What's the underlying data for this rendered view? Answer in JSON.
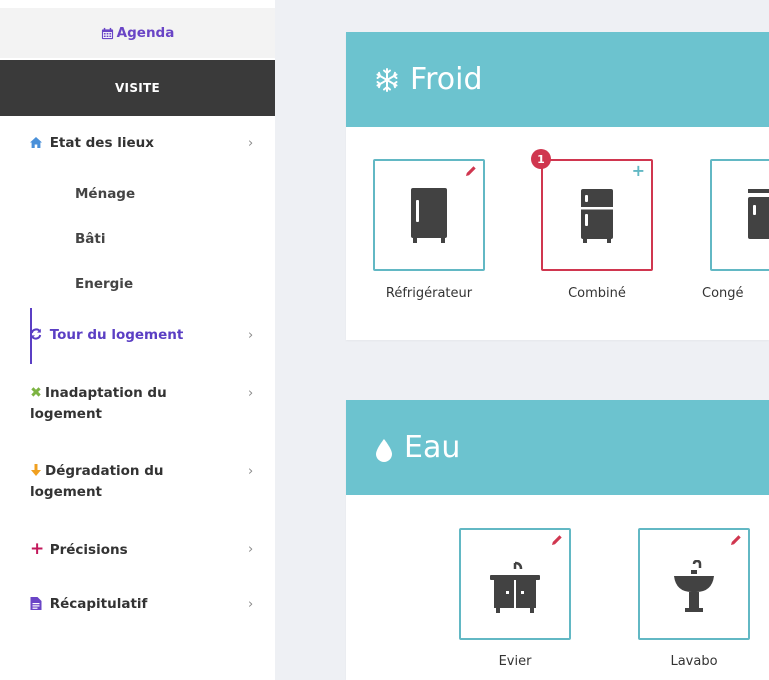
{
  "sidebar": {
    "agenda_label": "Agenda",
    "section_label": "VISITE",
    "items": [
      {
        "label": "Etat des lieux",
        "icon": "home-icon",
        "color": "#4a90d9"
      },
      {
        "label": "Tour du logement",
        "icon": "refresh-icon",
        "color": "#5b3fc4",
        "active": true
      },
      {
        "label": "Inadaptation du logement",
        "icon": "times-icon",
        "color": "#7cb342"
      },
      {
        "label": "Dégradation du logement",
        "icon": "arrow-down-icon",
        "color": "#f0a020"
      },
      {
        "label": "Précisions",
        "icon": "plus-icon",
        "color": "#c2185b"
      },
      {
        "label": "Récapitulatif",
        "icon": "file-icon",
        "color": "#6a45c6"
      }
    ],
    "sub_items": [
      {
        "label": "Ménage"
      },
      {
        "label": "Bâti"
      },
      {
        "label": "Energie"
      }
    ],
    "chevron": "›"
  },
  "sections": [
    {
      "title": "Froid",
      "icon": "snowflake-icon",
      "tiles": [
        {
          "label": "Réfrigérateur",
          "icon": "refrigerator-icon",
          "action": "edit"
        },
        {
          "label": "Combiné",
          "icon": "combined-fridge-icon",
          "action": "add",
          "badge": "1"
        },
        {
          "label": "Congé",
          "icon": "freezer-icon",
          "action": "edit"
        }
      ]
    },
    {
      "title": "Eau",
      "icon": "water-drop-icon",
      "tiles": [
        {
          "label": "Evier",
          "icon": "sink-icon",
          "action": "edit"
        },
        {
          "label": "Lavabo",
          "icon": "washbasin-icon",
          "action": "edit"
        }
      ]
    }
  ],
  "colors": {
    "header_teal": "#6cc3cf",
    "tile_border": "#62b8c4",
    "selected_border": "#d0364f",
    "accent_purple": "#5b3fc4"
  }
}
